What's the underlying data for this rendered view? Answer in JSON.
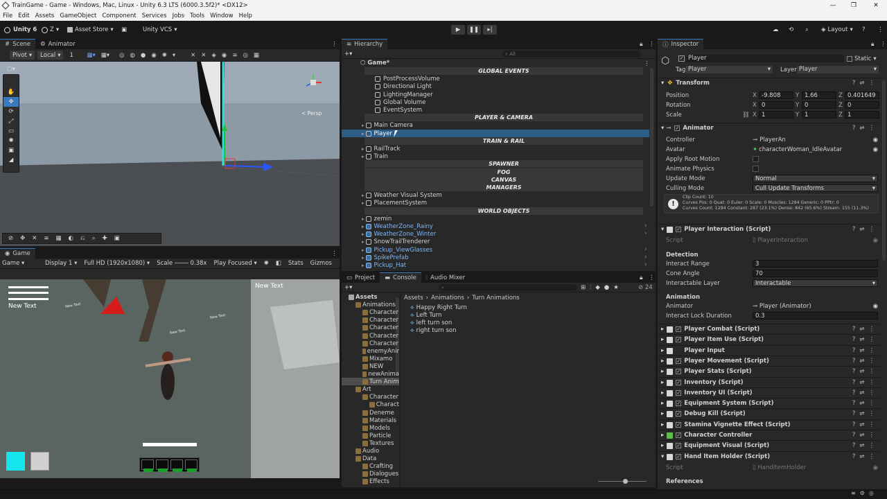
{
  "window": {
    "title": "TrainGame - Game - Windows, Mac, Linux - Unity 6.3 LTS (6000.3.5f2)* <DX12>"
  },
  "menu": [
    "File",
    "Edit",
    "Assets",
    "GameObject",
    "Component",
    "Services",
    "Jobs",
    "Tools",
    "Window",
    "Help"
  ],
  "toolbar": {
    "account": "Unity 6",
    "user": "Z",
    "asset_store": "Asset Store",
    "vcs": "Unity VCS",
    "layout": "Layout"
  },
  "scene": {
    "tabs": [
      "Scene",
      "Animator"
    ],
    "pivot": "Pivot",
    "local": "Local",
    "grid_snap": "1",
    "persp": "< Persp"
  },
  "game": {
    "tab": "Game",
    "display_mode": "Game",
    "display": "Display 1",
    "resolution": "Full HD (1920x1080)",
    "scale_label": "Scale",
    "scale_value": "0.38x",
    "play_mode": "Play Focused",
    "stats": "Stats",
    "gizmos": "Gizmos",
    "overlay_left": "New Text",
    "overlay_right": "New Text",
    "world_labels": [
      "New Text",
      "New Text",
      "New Text"
    ]
  },
  "hierarchy": {
    "tab": "Hierarchy",
    "search_placeholder": "All",
    "root": "Game*",
    "rows": [
      {
        "type": "header",
        "text": "GLOBAL EVENTS"
      },
      {
        "type": "item",
        "text": "PostProcessVolume",
        "indent": 2
      },
      {
        "type": "item",
        "text": "Directional Light",
        "indent": 2
      },
      {
        "type": "item",
        "text": "LightingManager",
        "indent": 2
      },
      {
        "type": "item",
        "text": "Global Volume",
        "indent": 2
      },
      {
        "type": "item",
        "text": "EventSystem",
        "indent": 2
      },
      {
        "type": "header",
        "text": "PLAYER & CAMERA"
      },
      {
        "type": "item",
        "text": "Main Camera",
        "indent": 1
      },
      {
        "type": "item",
        "text": "Player",
        "indent": 1,
        "selected": true
      },
      {
        "type": "header",
        "text": "TRAIN & RAIL"
      },
      {
        "type": "item",
        "text": "RailTrack",
        "indent": 1
      },
      {
        "type": "item",
        "text": "Train",
        "indent": 1
      },
      {
        "type": "header",
        "text": "SPAWNER"
      },
      {
        "type": "header",
        "text": "FOG"
      },
      {
        "type": "header",
        "text": "CANVAS"
      },
      {
        "type": "header",
        "text": "MANAGERS"
      },
      {
        "type": "item",
        "text": "Weather Visual System",
        "indent": 1
      },
      {
        "type": "item",
        "text": "PlacementSystem",
        "indent": 1
      },
      {
        "type": "header",
        "text": "WORLD OBJECTS"
      },
      {
        "type": "item",
        "text": "zemin",
        "indent": 1
      },
      {
        "type": "item",
        "text": "WeatherZone_Rainy",
        "indent": 1,
        "prefab": true
      },
      {
        "type": "item",
        "text": "WeatherZone_Winter",
        "indent": 1,
        "prefab": true
      },
      {
        "type": "item",
        "text": "SnowTrailTrenderer",
        "indent": 1
      },
      {
        "type": "item",
        "text": "Pickup_ViewGlasses",
        "indent": 1,
        "prefab": true
      },
      {
        "type": "item",
        "text": "SpikePrefab",
        "indent": 1,
        "prefab": true
      },
      {
        "type": "item",
        "text": "Pickup_Hat",
        "indent": 1,
        "prefab": true
      }
    ]
  },
  "project": {
    "tabs": [
      "Project",
      "Console",
      "Audio Mixer"
    ],
    "count": "24",
    "breadcrumb": [
      "Assets",
      "Animations",
      "Turn Animations"
    ],
    "tree": [
      {
        "text": "Assets",
        "level": 0,
        "bold": true
      },
      {
        "text": "Animations",
        "level": 1
      },
      {
        "text": "Character",
        "level": 2
      },
      {
        "text": "Character",
        "level": 2
      },
      {
        "text": "Character",
        "level": 2
      },
      {
        "text": "Character",
        "level": 2
      },
      {
        "text": "Character",
        "level": 2
      },
      {
        "text": "enemyAnir",
        "level": 2
      },
      {
        "text": "Mixamo",
        "level": 2
      },
      {
        "text": "NEW",
        "level": 2
      },
      {
        "text": "newAnima",
        "level": 2
      },
      {
        "text": "Turn Anim",
        "level": 2,
        "selected": true
      },
      {
        "text": "Art",
        "level": 1
      },
      {
        "text": "Character",
        "level": 2
      },
      {
        "text": "Charact",
        "level": 3
      },
      {
        "text": "Deneme",
        "level": 2
      },
      {
        "text": "Materials",
        "level": 2
      },
      {
        "text": "Models",
        "level": 2
      },
      {
        "text": "Particle",
        "level": 2
      },
      {
        "text": "Textures",
        "level": 2
      },
      {
        "text": "Audio",
        "level": 1
      },
      {
        "text": "Data",
        "level": 1
      },
      {
        "text": "Crafting",
        "level": 2
      },
      {
        "text": "Dialogues",
        "level": 2
      },
      {
        "text": "Effects",
        "level": 2
      }
    ],
    "files": [
      "Happy Right Turn",
      "Left Turn",
      "left turn son",
      "right turn son"
    ]
  },
  "inspector": {
    "tab": "Inspector",
    "name": "Player",
    "static": "Static",
    "tag_label": "Tag",
    "tag": "Player",
    "layer_label": "Layer",
    "layer": "Player",
    "transform": {
      "title": "Transform",
      "position_label": "Position",
      "pos": [
        "-9.808",
        "1.66",
        "0.401649"
      ],
      "rotation_label": "Rotation",
      "rot": [
        "0",
        "0",
        "0"
      ],
      "scale_label": "Scale",
      "scale": [
        "1",
        "1",
        "1"
      ]
    },
    "animator": {
      "title": "Animator",
      "controller_label": "Controller",
      "controller": "PlayerAn",
      "avatar_label": "Avatar",
      "avatar": "characterWoman_IdleAvatar",
      "root_motion": "Apply Root Motion",
      "anim_physics": "Animate Physics",
      "update_label": "Update Mode",
      "update": "Normal",
      "culling_label": "Culling Mode",
      "culling": "Cull Update Transforms",
      "info1": "Clip Count: 10",
      "info2": "Curves Pos: 0 Quat: 0 Euler: 0 Scale: 0 Muscles: 1284 Generic: 0 PPtr: 0",
      "info3": "Curves Count: 1284 Constant: 287 (23.1%) Dense: 842 (65.6%) Stream: 155 (11.3%)"
    },
    "interaction": {
      "title": "Player Interaction (Script)",
      "script_label": "Script",
      "script": "PlayerInteraction",
      "detection": "Detection",
      "range_label": "Interact Range",
      "range": "3",
      "cone_label": "Cone Angle",
      "cone": "70",
      "layer_label": "Interactable Layer",
      "layer": "Interactable",
      "animation": "Animation",
      "animator_label": "Animator",
      "animator": "Player (Animator)",
      "lock_label": "Interact Lock Duration",
      "lock": "0.3"
    },
    "components": [
      "Player Combat (Script)",
      "Player Item Use (Script)",
      "Player Input",
      "Player Movement (Script)",
      "Player Stats (Script)",
      "Inventory (Script)",
      "Inventory UI (Script)",
      "Equipment System (Script)",
      "Debug Kill (Script)",
      "Stamina Vignette Effect (Script)",
      "Character Controller",
      "Equipment Visual (Script)",
      "Hand Item Holder (Script)"
    ],
    "hand_script_label": "Script",
    "hand_script": "HandItemHolder",
    "references": "References"
  }
}
